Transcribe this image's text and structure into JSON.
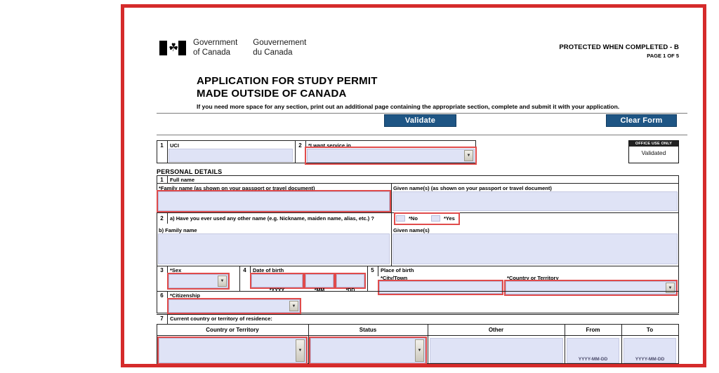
{
  "document": {
    "wordmark": {
      "en_line1": "Government",
      "en_line2": "of Canada",
      "fr_line1": "Gouvernement",
      "fr_line2": "du Canada",
      "flag_icon": "canada-flag-icon",
      "maple_leaf": "☘"
    },
    "protected_notice": "PROTECTED WHEN COMPLETED - B",
    "page_indicator": "PAGE 1 OF 5",
    "title_line1": "APPLICATION FOR STUDY PERMIT",
    "title_line2": "MADE OUTSIDE OF CANADA",
    "instruction": "If you need more space for any section, print out an additional page containing the appropriate section, complete and submit it with your application."
  },
  "toolbar": {
    "validate_label": "Validate",
    "clear_label": "Clear Form",
    "button_color": "#1e5584"
  },
  "office_use": {
    "header": "OFFICE USE ONLY",
    "value": "Validated"
  },
  "top_row": {
    "uci": {
      "number": "1",
      "label": "UCI",
      "value": ""
    },
    "service_language": {
      "number": "2",
      "label": "*I want service in",
      "value": "",
      "dropdown_icon": "chevron-down-icon",
      "highlighted": true
    }
  },
  "personal_details": {
    "section_title": "PERSONAL DETAILS",
    "full_name": {
      "number": "1",
      "label": "Full name",
      "family_name_label": "*Family name (as shown on your passport or travel document)",
      "family_name_value": "",
      "given_name_label": "Given name(s) (as shown on your passport or travel document)",
      "given_name_value": ""
    },
    "other_name": {
      "number": "2",
      "question": "a) Have you ever used any other name (e.g. Nickname, maiden name, alias, etc.) ?",
      "option_no": "*No",
      "option_yes": "*Yes",
      "no_checked": false,
      "yes_checked": false,
      "family_name_label": "b) Family name",
      "family_name_value": "",
      "given_name_label": "Given name(s)",
      "given_name_value": ""
    },
    "sex": {
      "number": "3",
      "label": "*Sex",
      "value": "",
      "dropdown_icon": "chevron-down-icon"
    },
    "date_of_birth": {
      "number": "4",
      "label": "Date of birth",
      "yyyy_label": "*YYYY",
      "mm_label": "*MM",
      "dd_label": "*DD",
      "yyyy_value": "",
      "mm_value": "",
      "dd_value": ""
    },
    "place_of_birth": {
      "number": "5",
      "label": "Place of birth",
      "city_label": "*City/Town",
      "city_value": "",
      "country_label": "*Country or Territory",
      "country_value": "",
      "dropdown_icon": "chevron-down-icon"
    },
    "citizenship": {
      "number": "6",
      "label": "*Citizenship",
      "value": "",
      "dropdown_icon": "chevron-down-icon"
    },
    "residence": {
      "number": "7",
      "label": "Current country or territory of residence:",
      "columns": [
        "Country or Territory",
        "Status",
        "Other",
        "From",
        "To"
      ],
      "row": {
        "country": "",
        "status": "",
        "other": "",
        "from": "",
        "to": ""
      },
      "date_format_hint": "YYYY-MM-DD"
    }
  },
  "annotation": {
    "frame_color": "#d52b2b",
    "highlight_color": "#e04b4b"
  }
}
